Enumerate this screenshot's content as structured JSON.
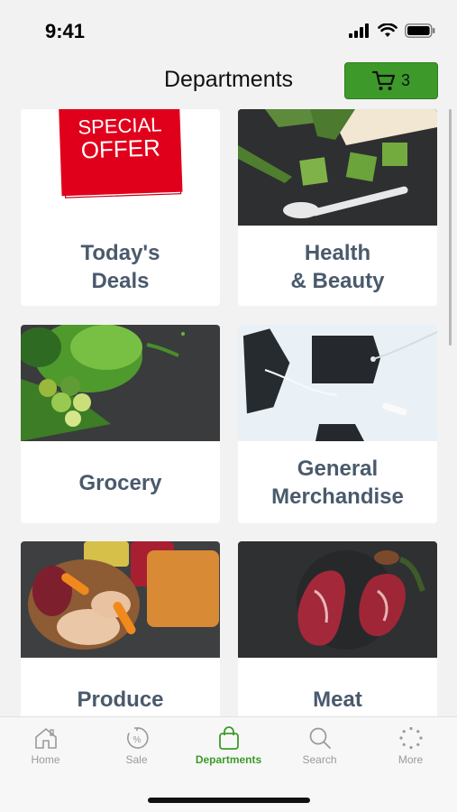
{
  "status": {
    "time": "9:41"
  },
  "header": {
    "title": "Departments",
    "cart_count": "3"
  },
  "departments": [
    {
      "label": "Today's\nDeals",
      "image": "special-offer",
      "image_text": "SPECIAL\nOFFER"
    },
    {
      "label": "Health\n& Beauty",
      "image": "aloe-vera"
    },
    {
      "label": "Grocery",
      "image": "vegetables"
    },
    {
      "label": "General\nMerchandise",
      "image": "tags"
    },
    {
      "label": "Produce",
      "image": "meal-prep"
    },
    {
      "label": "Meat",
      "image": "steaks"
    }
  ],
  "tabs": [
    {
      "label": "Home",
      "icon": "home-icon"
    },
    {
      "label": "Sale",
      "icon": "sale-icon"
    },
    {
      "label": "Departments",
      "icon": "bag-icon",
      "active": true
    },
    {
      "label": "Search",
      "icon": "search-icon"
    },
    {
      "label": "More",
      "icon": "more-icon"
    }
  ],
  "colors": {
    "accent": "#3d9a2a",
    "label": "#4a5a6c",
    "offer_red": "#e0001b"
  }
}
